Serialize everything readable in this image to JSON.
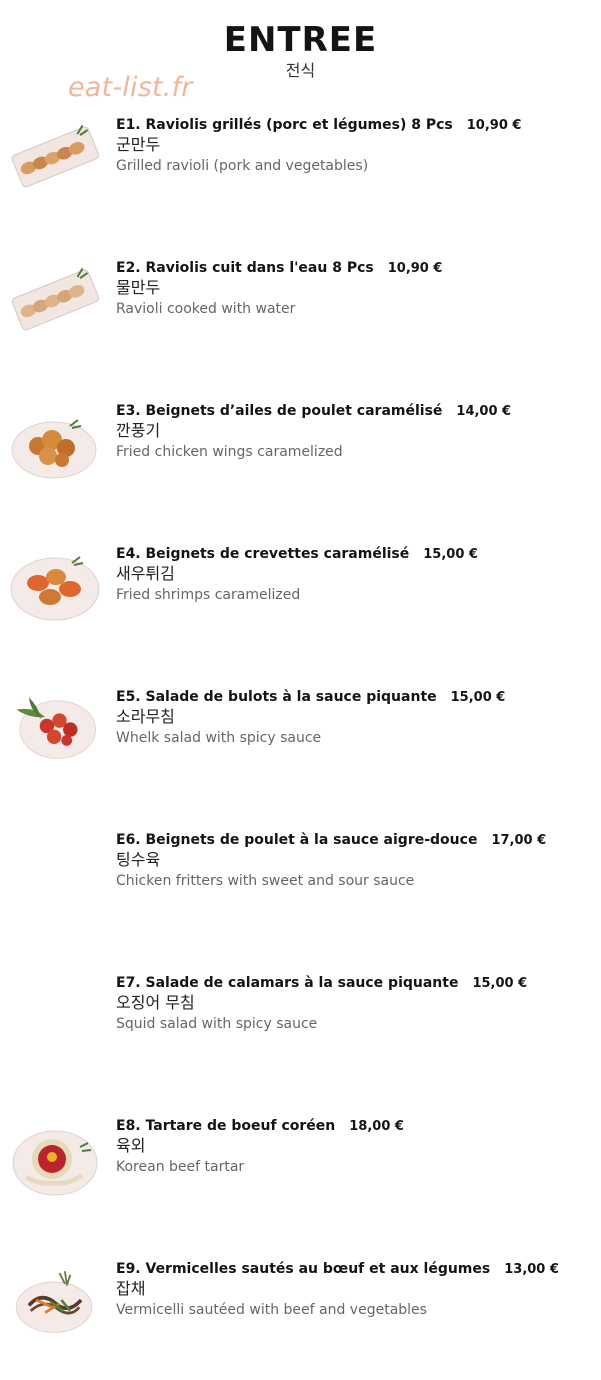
{
  "header": {
    "title": "ENTREE",
    "subtitle": "전식"
  },
  "watermark": "eat-list.fr",
  "items": [
    {
      "name": "E1. Raviolis grillés (porc et légumes) 8 Pcs",
      "price": "10,90 €",
      "korean": "군만두",
      "english": "Grilled ravioli (pork and vegetables)",
      "image": "dumplings-plate"
    },
    {
      "name": "E2. Raviolis cuit dans l'eau 8 Pcs",
      "price": "10,90 €",
      "korean": "물만두",
      "english": "Ravioli cooked with water",
      "image": "dumplings-plate"
    },
    {
      "name": "E3. Beignets d’ailes de poulet caramélisé",
      "price": "14,00 €",
      "korean": "깐풍기",
      "english": "Fried chicken wings caramelized",
      "image": "fried-chicken-plate"
    },
    {
      "name": "E4. Beignets de crevettes caramélisé",
      "price": "15,00 €",
      "korean": "새우튀김",
      "english": "Fried shrimps caramelized",
      "image": "fried-shrimp-plate"
    },
    {
      "name": "E5. Salade de bulots à la sauce piquante",
      "price": "15,00 €",
      "korean": "소라무침",
      "english": "Whelk salad with spicy sauce",
      "image": "whelk-salad-plate"
    },
    {
      "name": "E6. Beignets de poulet à la sauce aigre-douce",
      "price": "17,00 €",
      "korean": "팅수육",
      "english": "Chicken fritters with sweet and sour sauce",
      "image": ""
    },
    {
      "name": "E7. Salade de calamars à la sauce piquante",
      "price": "15,00 €",
      "korean": "오징어 무침",
      "english": "Squid salad with spicy sauce",
      "image": ""
    },
    {
      "name": "E8. Tartare de boeuf coréen",
      "price": "18,00 €",
      "korean": "육외",
      "english": "Korean beef tartar",
      "image": "beef-tartare-plate"
    },
    {
      "name": "E9. Vermicelles sautés au bœuf et aux légumes",
      "price": "13,00 €",
      "korean": "잡채",
      "english": "Vermicelli sautéed with beef and vegetables",
      "image": "japchae-plate"
    }
  ]
}
